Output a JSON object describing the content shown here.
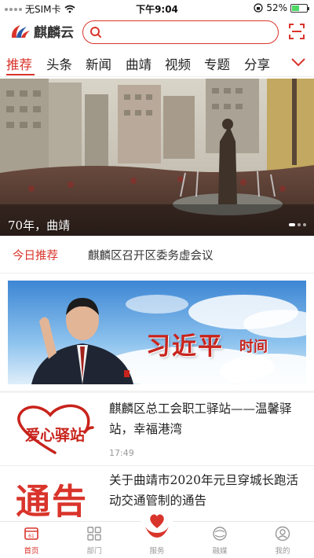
{
  "status_bar": {
    "carrier": "无SIM卡",
    "time": "下午9:04",
    "battery": "52%",
    "battery_level": 0.52
  },
  "header": {
    "app_name": "麒麟云",
    "search_placeholder": ""
  },
  "tabs": [
    {
      "label": "推荐",
      "active": true
    },
    {
      "label": "头条",
      "active": false
    },
    {
      "label": "新闻",
      "active": false
    },
    {
      "label": "曲靖",
      "active": false
    },
    {
      "label": "视频",
      "active": false
    },
    {
      "label": "专题",
      "active": false
    },
    {
      "label": "分享",
      "active": false
    }
  ],
  "hero": {
    "caption": "70年，曲靖"
  },
  "today": {
    "label": "今日推荐",
    "headline": "麒麟区召开区委务虚会议"
  },
  "banner": {
    "title": "习近平",
    "subtitle": "时间"
  },
  "news": [
    {
      "thumb_text": "爱心驿站",
      "title": "麒麟区总工会职工驿站——温馨驿站，幸福港湾",
      "time": "17:49"
    },
    {
      "thumb_text": "通告",
      "title": "关于曲靖市2020年元旦穿城长跑活动交通管制的通告",
      "time": ""
    }
  ],
  "bottom_nav": [
    {
      "label": "首页",
      "icon": "home-icon",
      "active": true
    },
    {
      "label": "部门",
      "icon": "grid-icon",
      "active": false
    },
    {
      "label": "服务",
      "icon": "heart-hands-icon",
      "active": false
    },
    {
      "label": "融媒",
      "icon": "media-icon",
      "active": false
    },
    {
      "label": "我的",
      "icon": "user-icon",
      "active": false
    }
  ],
  "colors": {
    "accent": "#d9342b",
    "battery": "#4cd964"
  }
}
